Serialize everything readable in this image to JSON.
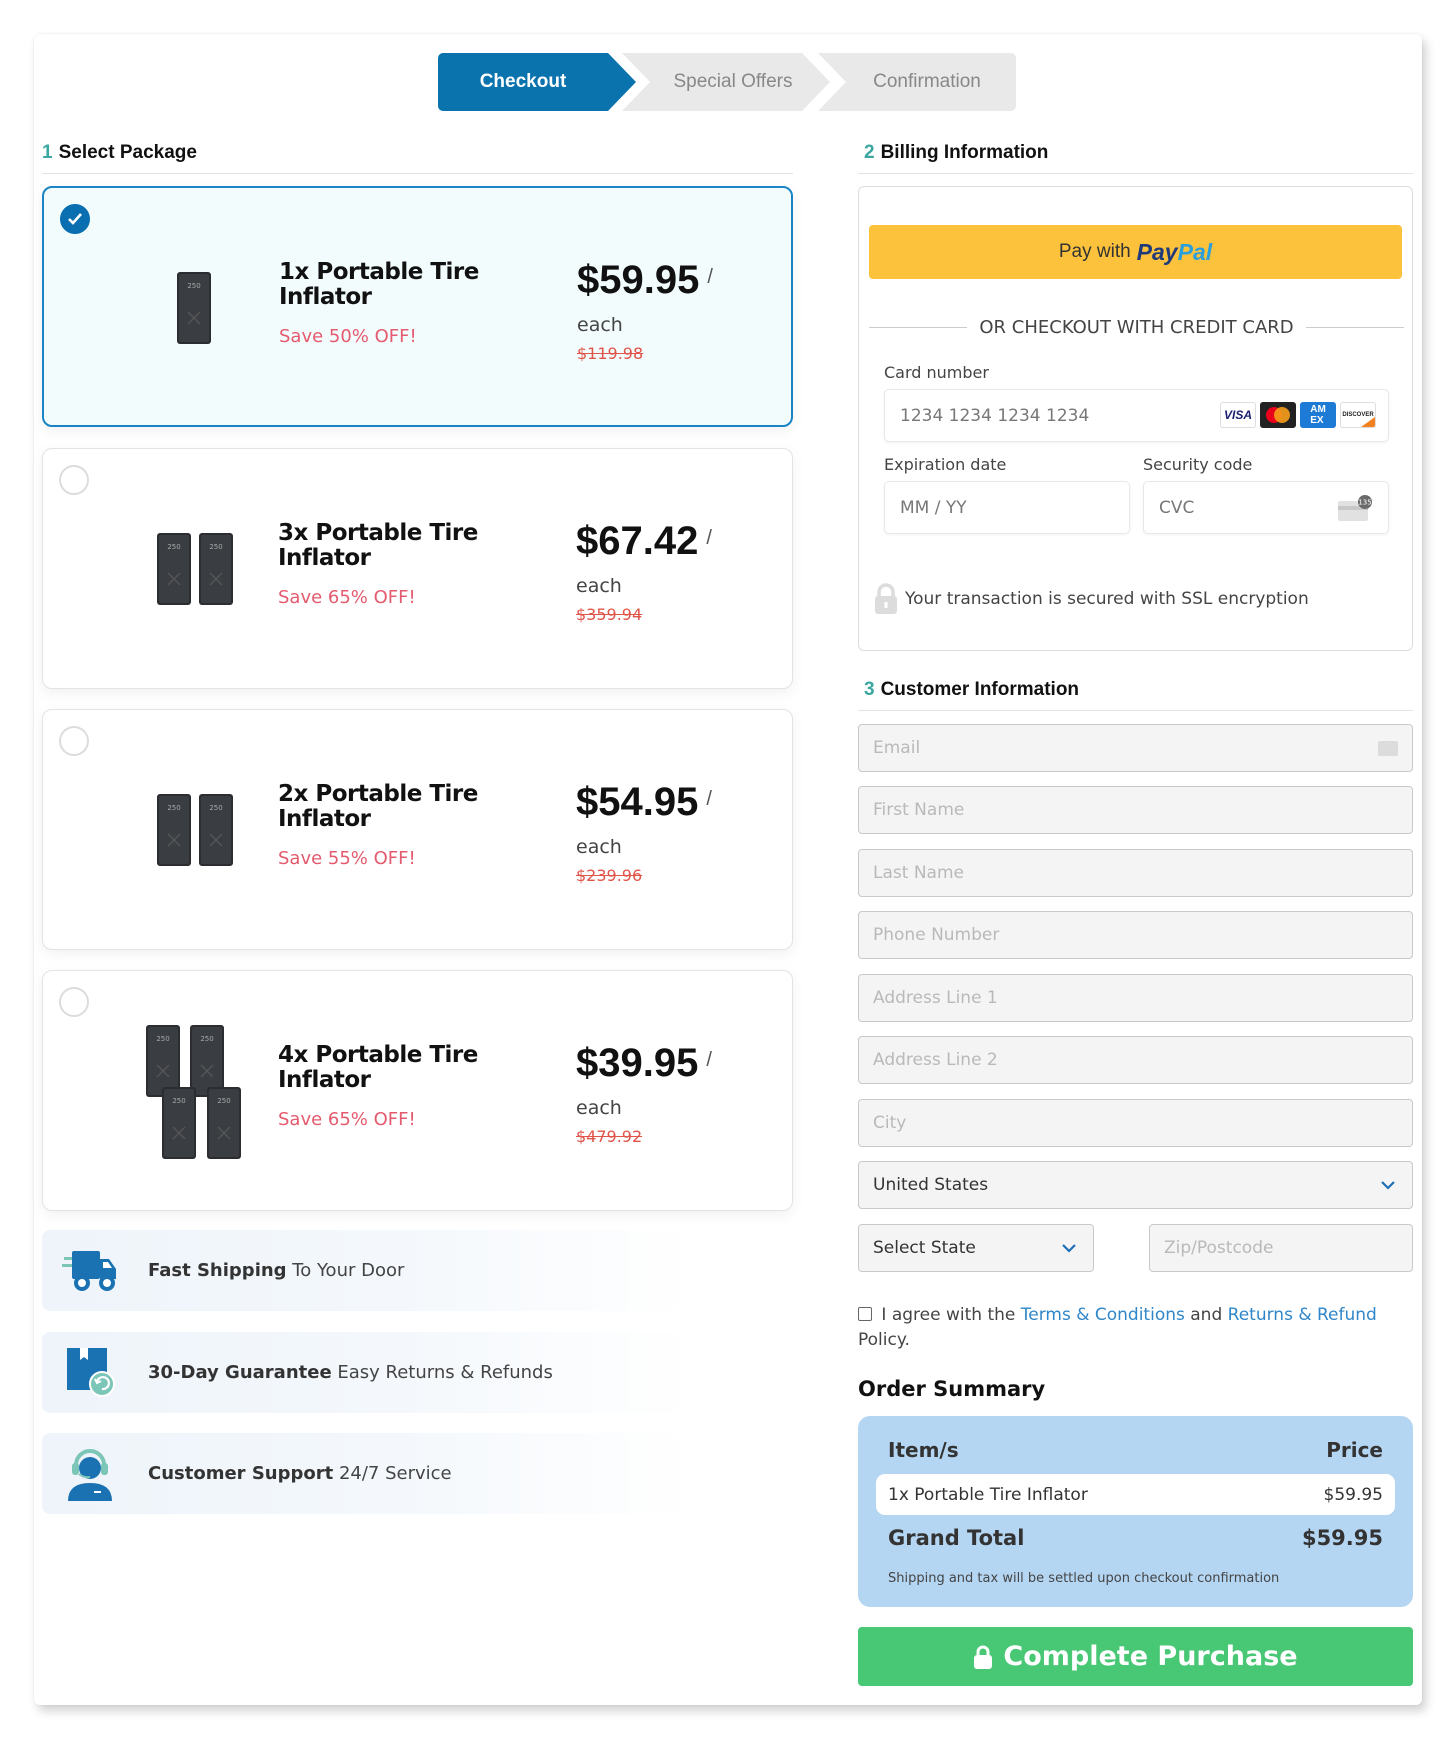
{
  "steps": [
    {
      "label": "Checkout",
      "active": true
    },
    {
      "label": "Special Offers",
      "active": false
    },
    {
      "label": "Confirmation",
      "active": false
    }
  ],
  "select_package": {
    "number": "1",
    "title": "Select Package",
    "packages": [
      {
        "name": "1x Portable Tire Inflator",
        "save": "Save 50% OFF!",
        "price": "$59.95",
        "slash": "/",
        "each": "each",
        "original": "$119.98",
        "selected": true,
        "units": 1
      },
      {
        "name": "3x Portable Tire Inflator",
        "save": "Save 65% OFF!",
        "price": "$67.42",
        "slash": "/",
        "each": "each",
        "original": "$359.94",
        "selected": false,
        "units": 2
      },
      {
        "name": "2x Portable Tire Inflator",
        "save": "Save 55% OFF!",
        "price": "$54.95",
        "slash": "/",
        "each": "each",
        "original": "$239.96",
        "selected": false,
        "units": 2
      },
      {
        "name": "4x Portable Tire Inflator",
        "save": "Save 65% OFF!",
        "price": "$39.95",
        "slash": "/",
        "each": "each",
        "original": "$479.92",
        "selected": false,
        "units": 4
      }
    ]
  },
  "features": [
    {
      "icon": "truck-icon",
      "bold": "Fast Shipping",
      "text": " To Your Door"
    },
    {
      "icon": "return-box-icon",
      "bold": "30-Day Guarantee",
      "text": " Easy Returns & Refunds"
    },
    {
      "icon": "support-agent-icon",
      "bold": "Customer Support",
      "text": " 24/7 Service"
    }
  ],
  "billing": {
    "number": "2",
    "title": "Billing Information",
    "paypal_prefix": "Pay with",
    "paypal_brand_1": "Pay",
    "paypal_brand_2": "Pal",
    "or_text": "OR CHECKOUT WITH CREDIT CARD",
    "card_number_label": "Card number",
    "card_number_placeholder": "1234 1234 1234 1234",
    "card_brands": [
      "VISA",
      "Mastercard",
      "AMEX",
      "DISCOVER"
    ],
    "expiry_label": "Expiration date",
    "expiry_placeholder": "MM / YY",
    "cvc_label": "Security code",
    "cvc_placeholder": "CVC",
    "cvc_badge": "135",
    "ssl_text": "Your transaction is secured with SSL encryption"
  },
  "customer": {
    "number": "3",
    "title": "Customer Information",
    "email_placeholder": "Email",
    "first_name_placeholder": "First Name",
    "last_name_placeholder": "Last Name",
    "phone_placeholder": "Phone Number",
    "address1_placeholder": "Address Line 1",
    "address2_placeholder": "Address Line 2",
    "city_placeholder": "City",
    "country_value": "United States",
    "state_value": "Select State",
    "zip_placeholder": "Zip/Postcode",
    "agree_prefix": " I agree with the ",
    "terms_link": "Terms & Conditions",
    "agree_mid": " and ",
    "refund_link": "Returns & Refund",
    "agree_suffix": " Policy."
  },
  "order_summary": {
    "title": "Order Summary",
    "col_item": "Item/s",
    "col_price": "Price",
    "item_name": "1x Portable Tire Inflator",
    "item_price": "$59.95",
    "grand_total_label": "Grand Total",
    "grand_total_value": "$59.95",
    "note": "Shipping and tax will be settled upon checkout confirmation"
  },
  "complete_button": "Complete Purchase",
  "colors": {
    "primary": "#0a73ad",
    "accent_teal": "#3aa7a0",
    "save_red": "#e45a6e",
    "paypal_yellow": "#fdc23b",
    "summary_blue": "#b5d6f3",
    "complete_green": "#48c774",
    "link_blue": "#2f86c9"
  }
}
